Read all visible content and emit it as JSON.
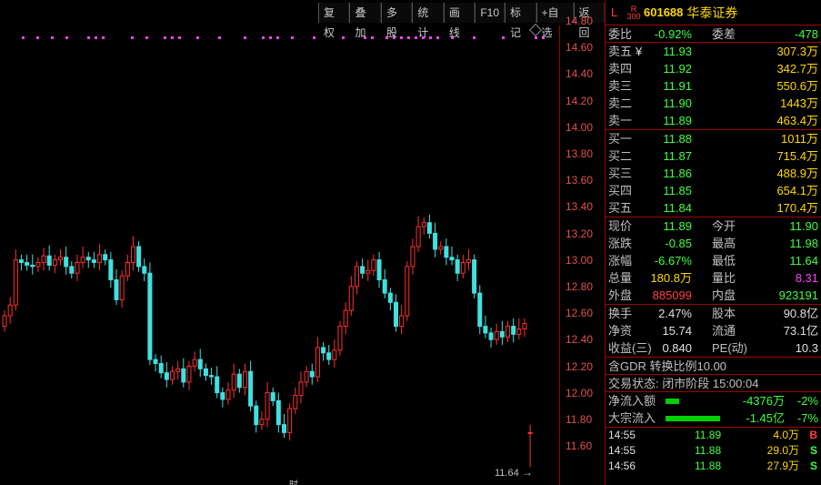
{
  "toolbar": [
    "复权",
    "叠加",
    "多股",
    "统计",
    "画线",
    "F10",
    "标记",
    "+自选",
    "返回"
  ],
  "price_axis": [
    "14.80",
    "14.60",
    "14.40",
    "14.20",
    "14.00",
    "13.80",
    "13.60",
    "13.40",
    "13.20",
    "13.00",
    "12.80",
    "12.60",
    "12.40",
    "12.20",
    "12.00",
    "11.80",
    "11.60"
  ],
  "chart": {
    "low_label": "11.64",
    "arrow": "→",
    "time_marker": "时",
    "colors": {
      "up": "#ff3030",
      "down": "#40e0e0",
      "signal": "#ff40ff"
    }
  },
  "header": {
    "l": "L",
    "r_top": "R",
    "r_bottom": "300",
    "code": "601688",
    "name": "华泰证券"
  },
  "ratio": {
    "label": "委比",
    "value": "-0.92%",
    "label2": "委差",
    "value2": "-478"
  },
  "asks": [
    {
      "label": "卖五",
      "mark": "¥",
      "price": "11.93",
      "vol": "307.3万"
    },
    {
      "label": "卖四",
      "mark": "",
      "price": "11.92",
      "vol": "342.7万"
    },
    {
      "label": "卖三",
      "mark": "",
      "price": "11.91",
      "vol": "550.6万"
    },
    {
      "label": "卖二",
      "mark": "",
      "price": "11.90",
      "vol": "1443万"
    },
    {
      "label": "卖一",
      "mark": "",
      "price": "11.89",
      "vol": "463.4万"
    }
  ],
  "bids": [
    {
      "label": "买一",
      "price": "11.88",
      "vol": "1011万"
    },
    {
      "label": "买二",
      "price": "11.87",
      "vol": "715.4万"
    },
    {
      "label": "买三",
      "price": "11.86",
      "vol": "488.9万"
    },
    {
      "label": "买四",
      "price": "11.85",
      "vol": "654.1万"
    },
    {
      "label": "买五",
      "price": "11.84",
      "vol": "170.4万"
    }
  ],
  "stats": [
    {
      "l1": "现价",
      "v1": "11.89",
      "c1": "green",
      "l2": "今开",
      "v2": "11.90",
      "c2": "green"
    },
    {
      "l1": "涨跌",
      "v1": "-0.85",
      "c1": "green",
      "l2": "最高",
      "v2": "11.98",
      "c2": "green"
    },
    {
      "l1": "涨幅",
      "v1": "-6.67%",
      "c1": "green",
      "l2": "最低",
      "v2": "11.64",
      "c2": "green"
    },
    {
      "l1": "总量",
      "v1": "180.8万",
      "c1": "yellow",
      "l2": "量比",
      "v2": "8.31",
      "c2": "purple"
    },
    {
      "l1": "外盘",
      "v1": "885099",
      "c1": "red",
      "l2": "内盘",
      "v2": "923191",
      "c2": "green"
    }
  ],
  "stats2": [
    {
      "l1": "换手",
      "v1": "2.47%",
      "l2": "股本",
      "v2": "90.8亿"
    },
    {
      "l1": "净资",
      "v1": "15.74",
      "l2": "流通",
      "v2": "73.1亿"
    },
    {
      "l1": "收益(三)",
      "v1": "0.840",
      "l2": "PE(动)",
      "v2": "10.3"
    }
  ],
  "gdr": "含GDR 转换比例10.00",
  "status": "交易状态: 闭市阶段 15:00:04",
  "flows": [
    {
      "label": "净流入额",
      "value": "-4376万",
      "pct": "-2%",
      "bar_fraction": 0.25
    },
    {
      "label": "大宗流入",
      "value": "-1.45亿",
      "pct": "-7%",
      "bar_fraction": 1.0
    }
  ],
  "ticks": [
    {
      "time": "14:55",
      "price": "11.89",
      "vol": "4.0万",
      "side": "B"
    },
    {
      "time": "14:55",
      "price": "11.88",
      "vol": "29.0万",
      "side": "S"
    },
    {
      "time": "14:56",
      "price": "11.88",
      "vol": "27.9万",
      "side": "S"
    }
  ]
}
